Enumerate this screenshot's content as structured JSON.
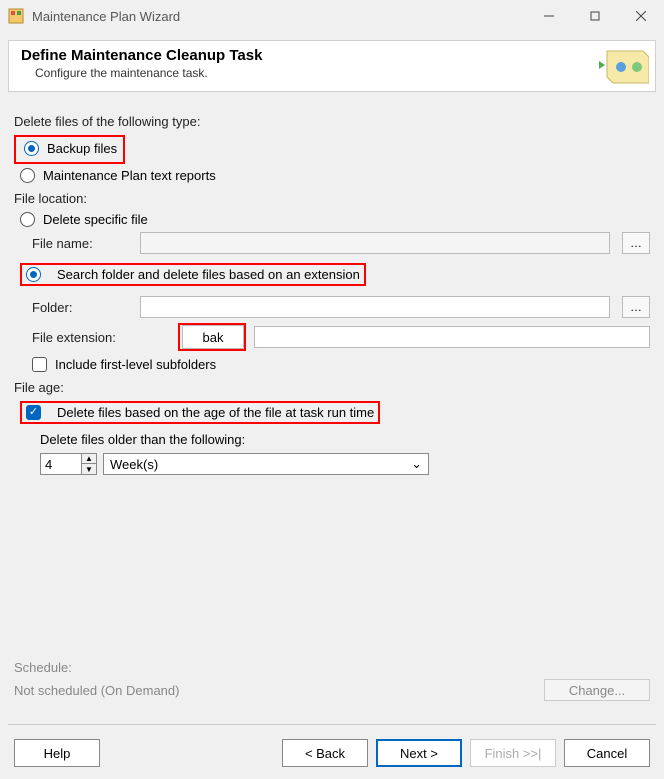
{
  "window": {
    "title": "Maintenance Plan Wizard"
  },
  "header": {
    "title": "Define Maintenance Cleanup Task",
    "subtitle": "Configure the maintenance task."
  },
  "sections": {
    "delete_type_label": "Delete files of the following type:",
    "radio_backup": "Backup files",
    "radio_reports": "Maintenance Plan text reports",
    "file_location_label": "File location:",
    "radio_specific": "Delete specific file",
    "file_name_label": "File name:",
    "radio_search": "Search folder and delete files based on an extension",
    "folder_label": "Folder:",
    "ext_label": "File extension:",
    "ext_value": "bak",
    "include_sub": "Include first-level subfolders",
    "file_age_label": "File age:",
    "delete_age_check": "Delete files based on the age of the file at task run time",
    "older_than_label": "Delete files older than the following:",
    "age_number": "4",
    "age_unit": "Week(s)"
  },
  "schedule": {
    "label": "Schedule:",
    "value": "Not scheduled (On Demand)",
    "change": "Change..."
  },
  "footer": {
    "help": "Help",
    "back": "< Back",
    "next": "Next >",
    "finish": "Finish >>|",
    "cancel": "Cancel"
  }
}
